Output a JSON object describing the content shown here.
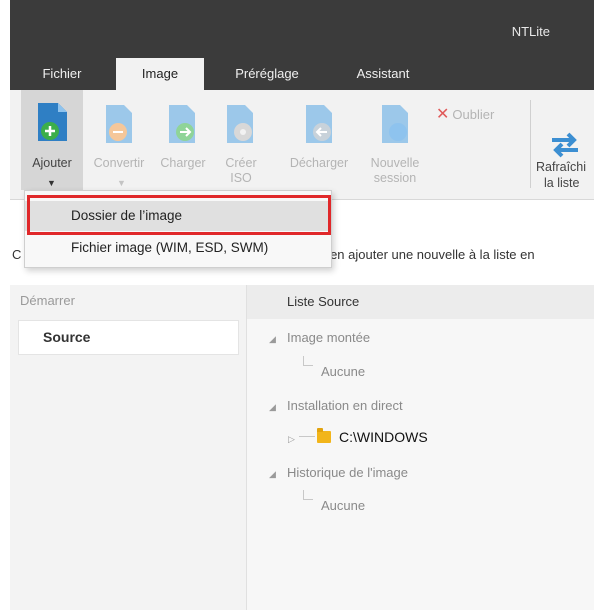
{
  "window": {
    "title": "NTLite"
  },
  "tabs": [
    {
      "label": "Fichier"
    },
    {
      "label": "Image"
    },
    {
      "label": "Préréglage"
    },
    {
      "label": "Assistant"
    }
  ],
  "ribbon": {
    "buttons": [
      {
        "label": "Ajouter",
        "icon": "add-image-icon",
        "enabled": true
      },
      {
        "label": "Convertir",
        "icon": "convert-image-icon",
        "enabled": false
      },
      {
        "label": "Charger",
        "icon": "load-image-icon",
        "enabled": false
      },
      {
        "label": "Créer ISO",
        "label_line1": "Créer",
        "label_line2": "ISO",
        "icon": "create-iso-icon",
        "enabled": false
      },
      {
        "label": "Décharger",
        "icon": "unload-image-icon",
        "enabled": false
      },
      {
        "label": "Nouvelle session",
        "label_line1": "Nouvelle",
        "label_line2": "session",
        "icon": "new-session-icon",
        "enabled": false
      },
      {
        "label": "Rafraîchir la liste",
        "label_line1": "Rafraîchi",
        "label_line2": "la liste",
        "icon": "refresh-icon",
        "enabled": true
      }
    ],
    "oublier": "Oublier"
  },
  "dropdown": {
    "items": [
      {
        "label": "Dossier de l’image"
      },
      {
        "label": "Fichier image (WIM, ESD, SWM)"
      }
    ]
  },
  "infobar": {
    "lead": "C",
    "text": "ou en ajouter une nouvelle à la liste en"
  },
  "sidebar": {
    "header": "Démarrer",
    "item": "Source"
  },
  "main": {
    "column_header": "Liste Source",
    "tree": [
      {
        "label": "Image montée",
        "child": "Aucune"
      },
      {
        "label": "Installation en direct",
        "child": "C:\\WINDOWS"
      },
      {
        "label": "Historique de l'image",
        "child": "Aucune"
      }
    ]
  },
  "colors": {
    "titlebar": "#3b3b3b",
    "ribbon": "#f2f2f2",
    "accent_blue": "#3c8fd2",
    "green": "#3cae4a",
    "highlight_red": "#e0282a",
    "folder": "#f2b51a"
  }
}
